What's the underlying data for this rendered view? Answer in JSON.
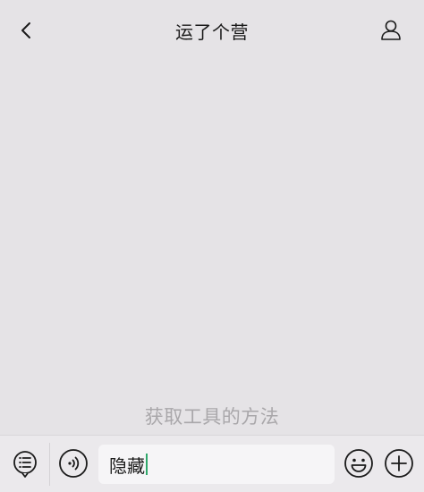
{
  "header": {
    "title": "运了个营",
    "back_icon": "chevron-left-icon",
    "profile_icon": "person-icon"
  },
  "chat": {
    "hint": "获取工具的方法"
  },
  "input_bar": {
    "menu_icon": "menu-list-icon",
    "voice_icon": "voice-icon",
    "input_value": "隐藏",
    "emoji_icon": "emoji-icon",
    "plus_icon": "plus-icon",
    "caret_color": "#2fa86b"
  }
}
